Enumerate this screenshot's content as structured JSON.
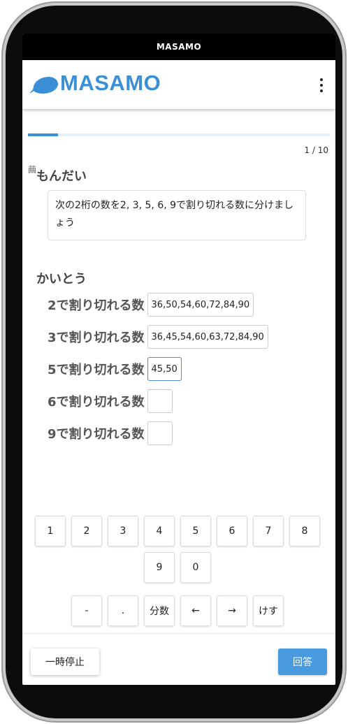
{
  "status_bar": {
    "title": "MASAMO"
  },
  "app_bar": {
    "logo_text": "MASAMO",
    "brand_color": "#3a8fd6",
    "menu_icon": "more-vertical-icon"
  },
  "progress": {
    "current": 1,
    "total": 10,
    "fraction": 0.1,
    "indicator": "1 / 10"
  },
  "question": {
    "pin_icon": "pushpin-icon",
    "heading": "もんだい",
    "text": "次の2桁の数を2, 3, 5, 6, 9で割り切れる数に分けましょう"
  },
  "answer": {
    "heading": "かいとう",
    "rows": [
      {
        "label": "2で割り切れる数",
        "value": "36,50,54,60,72,84,90"
      },
      {
        "label": "3で割り切れる数",
        "value": "36,45,54,60,63,72,84,90"
      },
      {
        "label": "5で割り切れる数",
        "value": "45,50"
      },
      {
        "label": "6で割り切れる数",
        "value": ""
      },
      {
        "label": "9で割り切れる数",
        "value": ""
      }
    ]
  },
  "keypad": {
    "digits": [
      "1",
      "2",
      "3",
      "4",
      "5",
      "6",
      "7",
      "8",
      "9",
      "0"
    ],
    "specials": [
      "-",
      ".",
      "分数",
      "←",
      "→",
      "けす"
    ]
  },
  "footer": {
    "pause_label": "一時停止",
    "submit_label": "回答",
    "submit_color": "#4a9ae0"
  }
}
